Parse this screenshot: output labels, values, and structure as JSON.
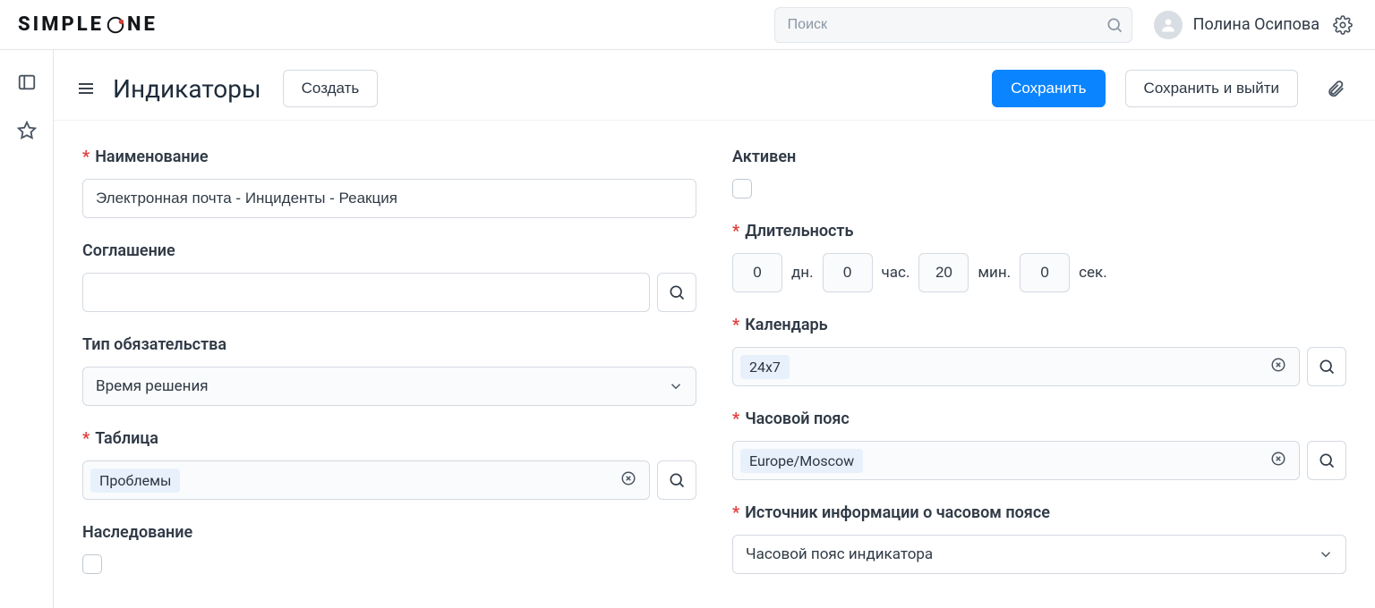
{
  "brand": "SIMPLEONE",
  "search_placeholder": "Поиск",
  "user_name": "Полина Осипова",
  "header": {
    "title": "Индикаторы",
    "create_button": "Создать",
    "save_button": "Сохранить",
    "save_exit_button": "Сохранить и выйти"
  },
  "form": {
    "name_label": "Наименование",
    "name_value": "Электронная почта - Инциденты - Реакция",
    "agreement_label": "Соглашение",
    "agreement_value": "",
    "commitment_type_label": "Тип обязательства",
    "commitment_type_value": "Время решения",
    "table_label": "Таблица",
    "table_chip": "Проблемы",
    "inheritance_label": "Наследование",
    "active_label": "Активен",
    "duration_label": "Длительность",
    "duration": {
      "days": "0",
      "days_unit": "дн.",
      "hours": "0",
      "hours_unit": "час.",
      "minutes": "20",
      "minutes_unit": "мин.",
      "seconds": "0",
      "seconds_unit": "сек."
    },
    "calendar_label": "Календарь",
    "calendar_chip": "24x7",
    "timezone_label": "Часовой пояс",
    "timezone_chip": "Europe/Moscow",
    "tz_source_label": "Источник информации о часовом поясе",
    "tz_source_value": "Часовой пояс индикатора"
  }
}
